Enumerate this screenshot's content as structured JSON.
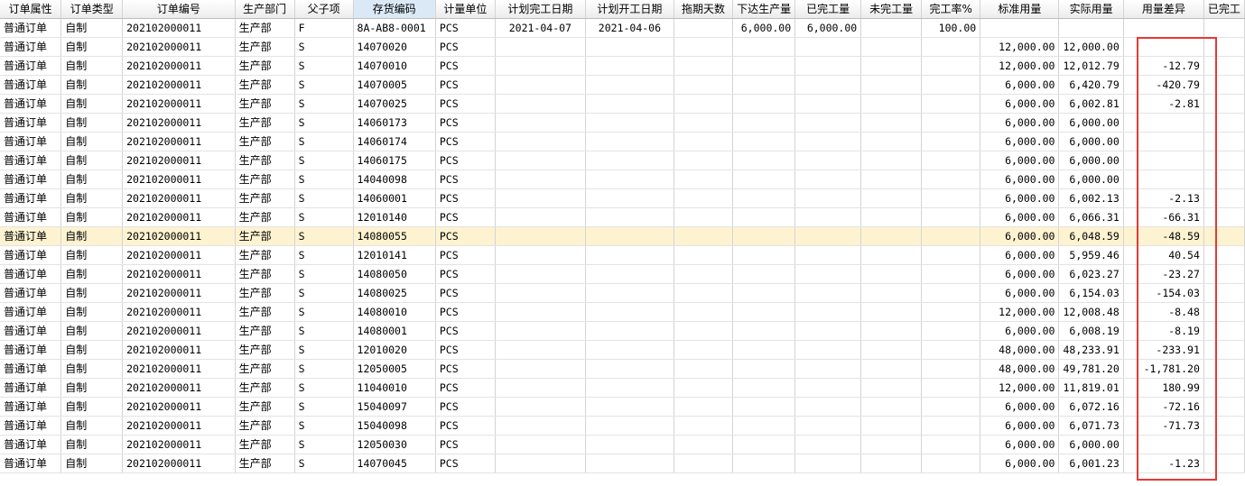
{
  "columns": [
    {
      "key": "attr",
      "label": "订单属性",
      "w": 69
    },
    {
      "key": "type",
      "label": "订单类型",
      "w": 69
    },
    {
      "key": "order",
      "label": "订单编号",
      "w": 128
    },
    {
      "key": "dept",
      "label": "生产部门",
      "w": 67
    },
    {
      "key": "pc",
      "label": "父子项",
      "w": 67
    },
    {
      "key": "inv",
      "label": "存货编码",
      "w": 92
    },
    {
      "key": "unit",
      "label": "计量单位",
      "w": 67
    },
    {
      "key": "plan_end",
      "label": "计划完工日期",
      "w": 102
    },
    {
      "key": "plan_start",
      "label": "计划开工日期",
      "w": 100
    },
    {
      "key": "delay",
      "label": "拖期天数",
      "w": 66
    },
    {
      "key": "issued",
      "label": "下达生产量",
      "w": 68
    },
    {
      "key": "done",
      "label": "已完工量",
      "w": 74
    },
    {
      "key": "undone",
      "label": "未完工量",
      "w": 68
    },
    {
      "key": "rate",
      "label": "完工率%",
      "w": 66
    },
    {
      "key": "std",
      "label": "标准用量",
      "w": 89
    },
    {
      "key": "actual",
      "label": "实际用量",
      "w": 68
    },
    {
      "key": "diff",
      "label": "用量差异",
      "w": 91
    },
    {
      "key": "last",
      "label": "已完工",
      "w": 30
    }
  ],
  "rows": [
    {
      "attr": "普通订单",
      "type": "自制",
      "order": "202102000011",
      "dept": "生产部",
      "pc": "F",
      "inv": "8A-AB8-0001",
      "unit": "PCS",
      "plan_end": "2021-04-07",
      "plan_start": "2021-04-06",
      "issued": "6,000.00",
      "done": "6,000.00",
      "rate": "100.00"
    },
    {
      "attr": "普通订单",
      "type": "自制",
      "order": "202102000011",
      "dept": "生产部",
      "pc": "S",
      "inv": "14070020",
      "unit": "PCS",
      "std": "12,000.00",
      "actual": "12,000.00"
    },
    {
      "attr": "普通订单",
      "type": "自制",
      "order": "202102000011",
      "dept": "生产部",
      "pc": "S",
      "inv": "14070010",
      "unit": "PCS",
      "std": "12,000.00",
      "actual": "12,012.79",
      "diff": "-12.79"
    },
    {
      "attr": "普通订单",
      "type": "自制",
      "order": "202102000011",
      "dept": "生产部",
      "pc": "S",
      "inv": "14070005",
      "unit": "PCS",
      "std": "6,000.00",
      "actual": "6,420.79",
      "diff": "-420.79"
    },
    {
      "attr": "普通订单",
      "type": "自制",
      "order": "202102000011",
      "dept": "生产部",
      "pc": "S",
      "inv": "14070025",
      "unit": "PCS",
      "std": "6,000.00",
      "actual": "6,002.81",
      "diff": "-2.81"
    },
    {
      "attr": "普通订单",
      "type": "自制",
      "order": "202102000011",
      "dept": "生产部",
      "pc": "S",
      "inv": "14060173",
      "unit": "PCS",
      "std": "6,000.00",
      "actual": "6,000.00"
    },
    {
      "attr": "普通订单",
      "type": "自制",
      "order": "202102000011",
      "dept": "生产部",
      "pc": "S",
      "inv": "14060174",
      "unit": "PCS",
      "std": "6,000.00",
      "actual": "6,000.00"
    },
    {
      "attr": "普通订单",
      "type": "自制",
      "order": "202102000011",
      "dept": "生产部",
      "pc": "S",
      "inv": "14060175",
      "unit": "PCS",
      "std": "6,000.00",
      "actual": "6,000.00"
    },
    {
      "attr": "普通订单",
      "type": "自制",
      "order": "202102000011",
      "dept": "生产部",
      "pc": "S",
      "inv": "14040098",
      "unit": "PCS",
      "std": "6,000.00",
      "actual": "6,000.00"
    },
    {
      "attr": "普通订单",
      "type": "自制",
      "order": "202102000011",
      "dept": "生产部",
      "pc": "S",
      "inv": "14060001",
      "unit": "PCS",
      "std": "6,000.00",
      "actual": "6,002.13",
      "diff": "-2.13"
    },
    {
      "attr": "普通订单",
      "type": "自制",
      "order": "202102000011",
      "dept": "生产部",
      "pc": "S",
      "inv": "12010140",
      "unit": "PCS",
      "std": "6,000.00",
      "actual": "6,066.31",
      "diff": "-66.31"
    },
    {
      "attr": "普通订单",
      "type": "自制",
      "order": "202102000011",
      "dept": "生产部",
      "pc": "S",
      "inv": "14080055",
      "unit": "PCS",
      "std": "6,000.00",
      "actual": "6,048.59",
      "diff": "-48.59",
      "highlight": true
    },
    {
      "attr": "普通订单",
      "type": "自制",
      "order": "202102000011",
      "dept": "生产部",
      "pc": "S",
      "inv": "12010141",
      "unit": "PCS",
      "std": "6,000.00",
      "actual": "5,959.46",
      "diff": "40.54"
    },
    {
      "attr": "普通订单",
      "type": "自制",
      "order": "202102000011",
      "dept": "生产部",
      "pc": "S",
      "inv": "14080050",
      "unit": "PCS",
      "std": "6,000.00",
      "actual": "6,023.27",
      "diff": "-23.27"
    },
    {
      "attr": "普通订单",
      "type": "自制",
      "order": "202102000011",
      "dept": "生产部",
      "pc": "S",
      "inv": "14080025",
      "unit": "PCS",
      "std": "6,000.00",
      "actual": "6,154.03",
      "diff": "-154.03"
    },
    {
      "attr": "普通订单",
      "type": "自制",
      "order": "202102000011",
      "dept": "生产部",
      "pc": "S",
      "inv": "14080010",
      "unit": "PCS",
      "std": "12,000.00",
      "actual": "12,008.48",
      "diff": "-8.48"
    },
    {
      "attr": "普通订单",
      "type": "自制",
      "order": "202102000011",
      "dept": "生产部",
      "pc": "S",
      "inv": "14080001",
      "unit": "PCS",
      "std": "6,000.00",
      "actual": "6,008.19",
      "diff": "-8.19"
    },
    {
      "attr": "普通订单",
      "type": "自制",
      "order": "202102000011",
      "dept": "生产部",
      "pc": "S",
      "inv": "12010020",
      "unit": "PCS",
      "std": "48,000.00",
      "actual": "48,233.91",
      "diff": "-233.91"
    },
    {
      "attr": "普通订单",
      "type": "自制",
      "order": "202102000011",
      "dept": "生产部",
      "pc": "S",
      "inv": "12050005",
      "unit": "PCS",
      "std": "48,000.00",
      "actual": "49,781.20",
      "diff": "-1,781.20"
    },
    {
      "attr": "普通订单",
      "type": "自制",
      "order": "202102000011",
      "dept": "生产部",
      "pc": "S",
      "inv": "11040010",
      "unit": "PCS",
      "std": "12,000.00",
      "actual": "11,819.01",
      "diff": "180.99"
    },
    {
      "attr": "普通订单",
      "type": "自制",
      "order": "202102000011",
      "dept": "生产部",
      "pc": "S",
      "inv": "15040097",
      "unit": "PCS",
      "std": "6,000.00",
      "actual": "6,072.16",
      "diff": "-72.16"
    },
    {
      "attr": "普通订单",
      "type": "自制",
      "order": "202102000011",
      "dept": "生产部",
      "pc": "S",
      "inv": "15040098",
      "unit": "PCS",
      "std": "6,000.00",
      "actual": "6,071.73",
      "diff": "-71.73"
    },
    {
      "attr": "普通订单",
      "type": "自制",
      "order": "202102000011",
      "dept": "生产部",
      "pc": "S",
      "inv": "12050030",
      "unit": "PCS",
      "std": "6,000.00",
      "actual": "6,000.00"
    },
    {
      "attr": "普通订单",
      "type": "自制",
      "order": "202102000011",
      "dept": "生产部",
      "pc": "S",
      "inv": "14070045",
      "unit": "PCS",
      "std": "6,000.00",
      "actual": "6,001.23",
      "diff": "-1.23"
    }
  ],
  "colors": {
    "highlight_row": "#fdf3d1",
    "annotation_box": "#e53935",
    "selected_header": "#dbe9f7"
  },
  "selected_column": "inv"
}
